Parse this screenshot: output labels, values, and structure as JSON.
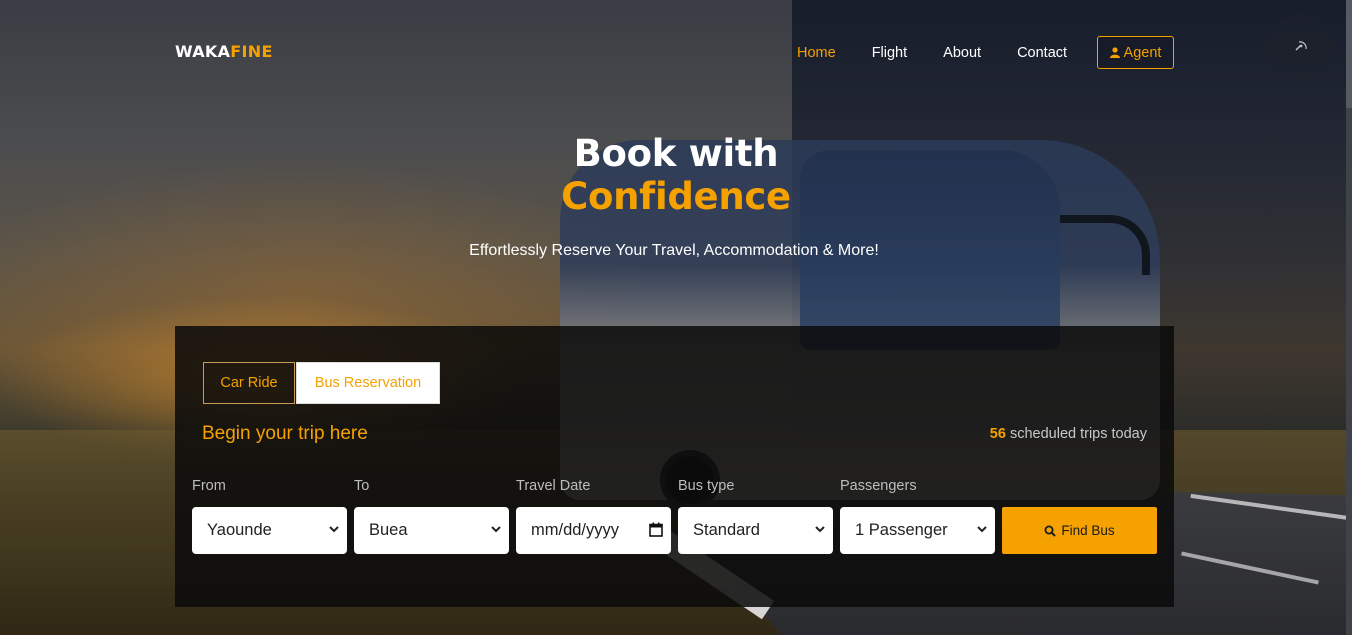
{
  "brand": {
    "part1": "WAKA",
    "part2": "FINE"
  },
  "nav": {
    "items": [
      {
        "label": "Home"
      },
      {
        "label": "Flight"
      },
      {
        "label": "About"
      },
      {
        "label": "Contact"
      }
    ],
    "agent_label": "Agent",
    "agent_icon": "user-icon"
  },
  "hero": {
    "title_line1": "Book with",
    "title_line2": "Confidence",
    "subtitle": "Effortlessly Reserve Your Travel, Accommodation & More!"
  },
  "booking": {
    "tabs": [
      {
        "label": "Car Ride"
      },
      {
        "label": "Bus Reservation"
      }
    ],
    "heading": "Begin your trip here",
    "trips_count": "56",
    "trips_text": "scheduled trips today",
    "fields": {
      "from": {
        "label": "From",
        "value": "Yaounde"
      },
      "to": {
        "label": "To",
        "value": "Buea"
      },
      "date": {
        "label": "Travel Date",
        "placeholder": "mm/dd/yyyy"
      },
      "bus_type": {
        "label": "Bus type",
        "value": "Standard"
      },
      "passengers": {
        "label": "Passengers",
        "value": "1 Passenger"
      }
    },
    "find_label": "Find Bus",
    "find_icon": "search-icon"
  },
  "colors": {
    "accent": "#f5a100",
    "panel": "#0a0a0a"
  }
}
